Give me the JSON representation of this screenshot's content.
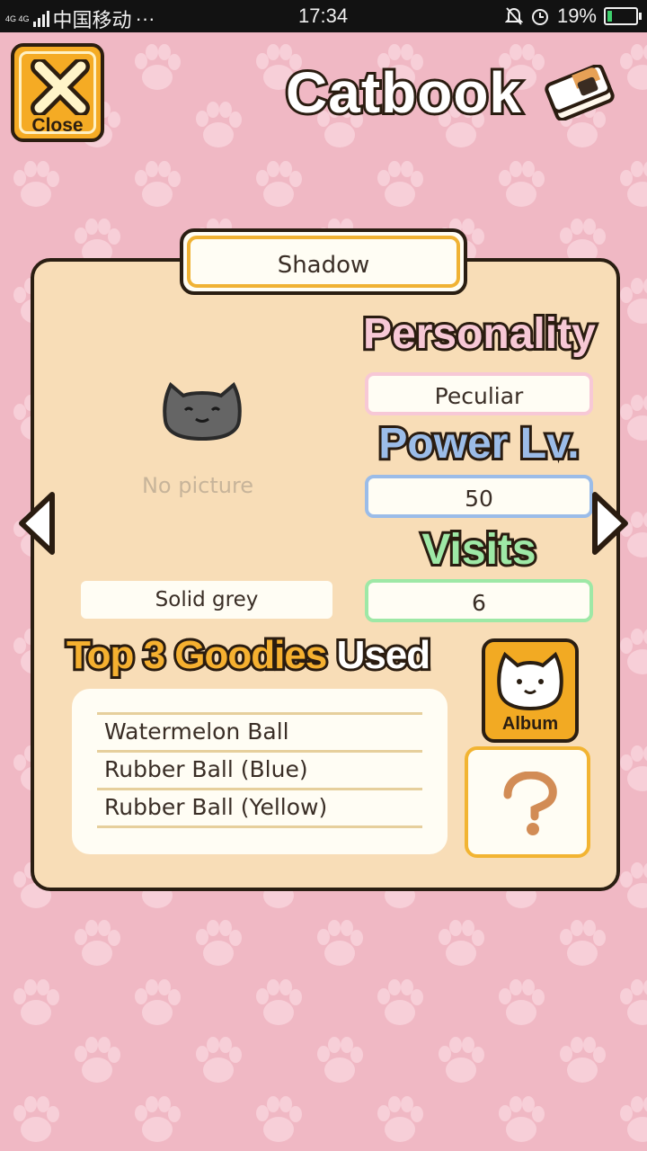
{
  "status_bar": {
    "network_type": "4G 4G",
    "carrier": "中国移动",
    "more": "···",
    "time": "17:34",
    "battery_percent": "19%",
    "battery_level": 0.19
  },
  "header": {
    "close_label": "Close",
    "title": "Catbook"
  },
  "cat": {
    "name": "Shadow",
    "photo_placeholder": "No picture",
    "coat": "Solid grey"
  },
  "stats": {
    "personality_label": "Personality",
    "personality_value": "Peculiar",
    "power_label": "Power Lv.",
    "power_value": "50",
    "visits_label": "Visits",
    "visits_value": "6"
  },
  "goodies": {
    "heading_top3": "Top 3",
    "heading_goodies": "Goodies",
    "heading_used": "Used",
    "items": [
      "Watermelon Ball",
      "Rubber Ball (Blue)",
      "Rubber Ball (Yellow)"
    ]
  },
  "side_buttons": {
    "album_label": "Album",
    "help_icon": "question-mark-icon"
  },
  "colors": {
    "background": "#f0b8c4",
    "panel": "#f8ddb7",
    "accent_orange": "#f2aa23",
    "personality": "#f7c8d6",
    "power": "#9bbce8",
    "visits": "#9ee8a6"
  }
}
